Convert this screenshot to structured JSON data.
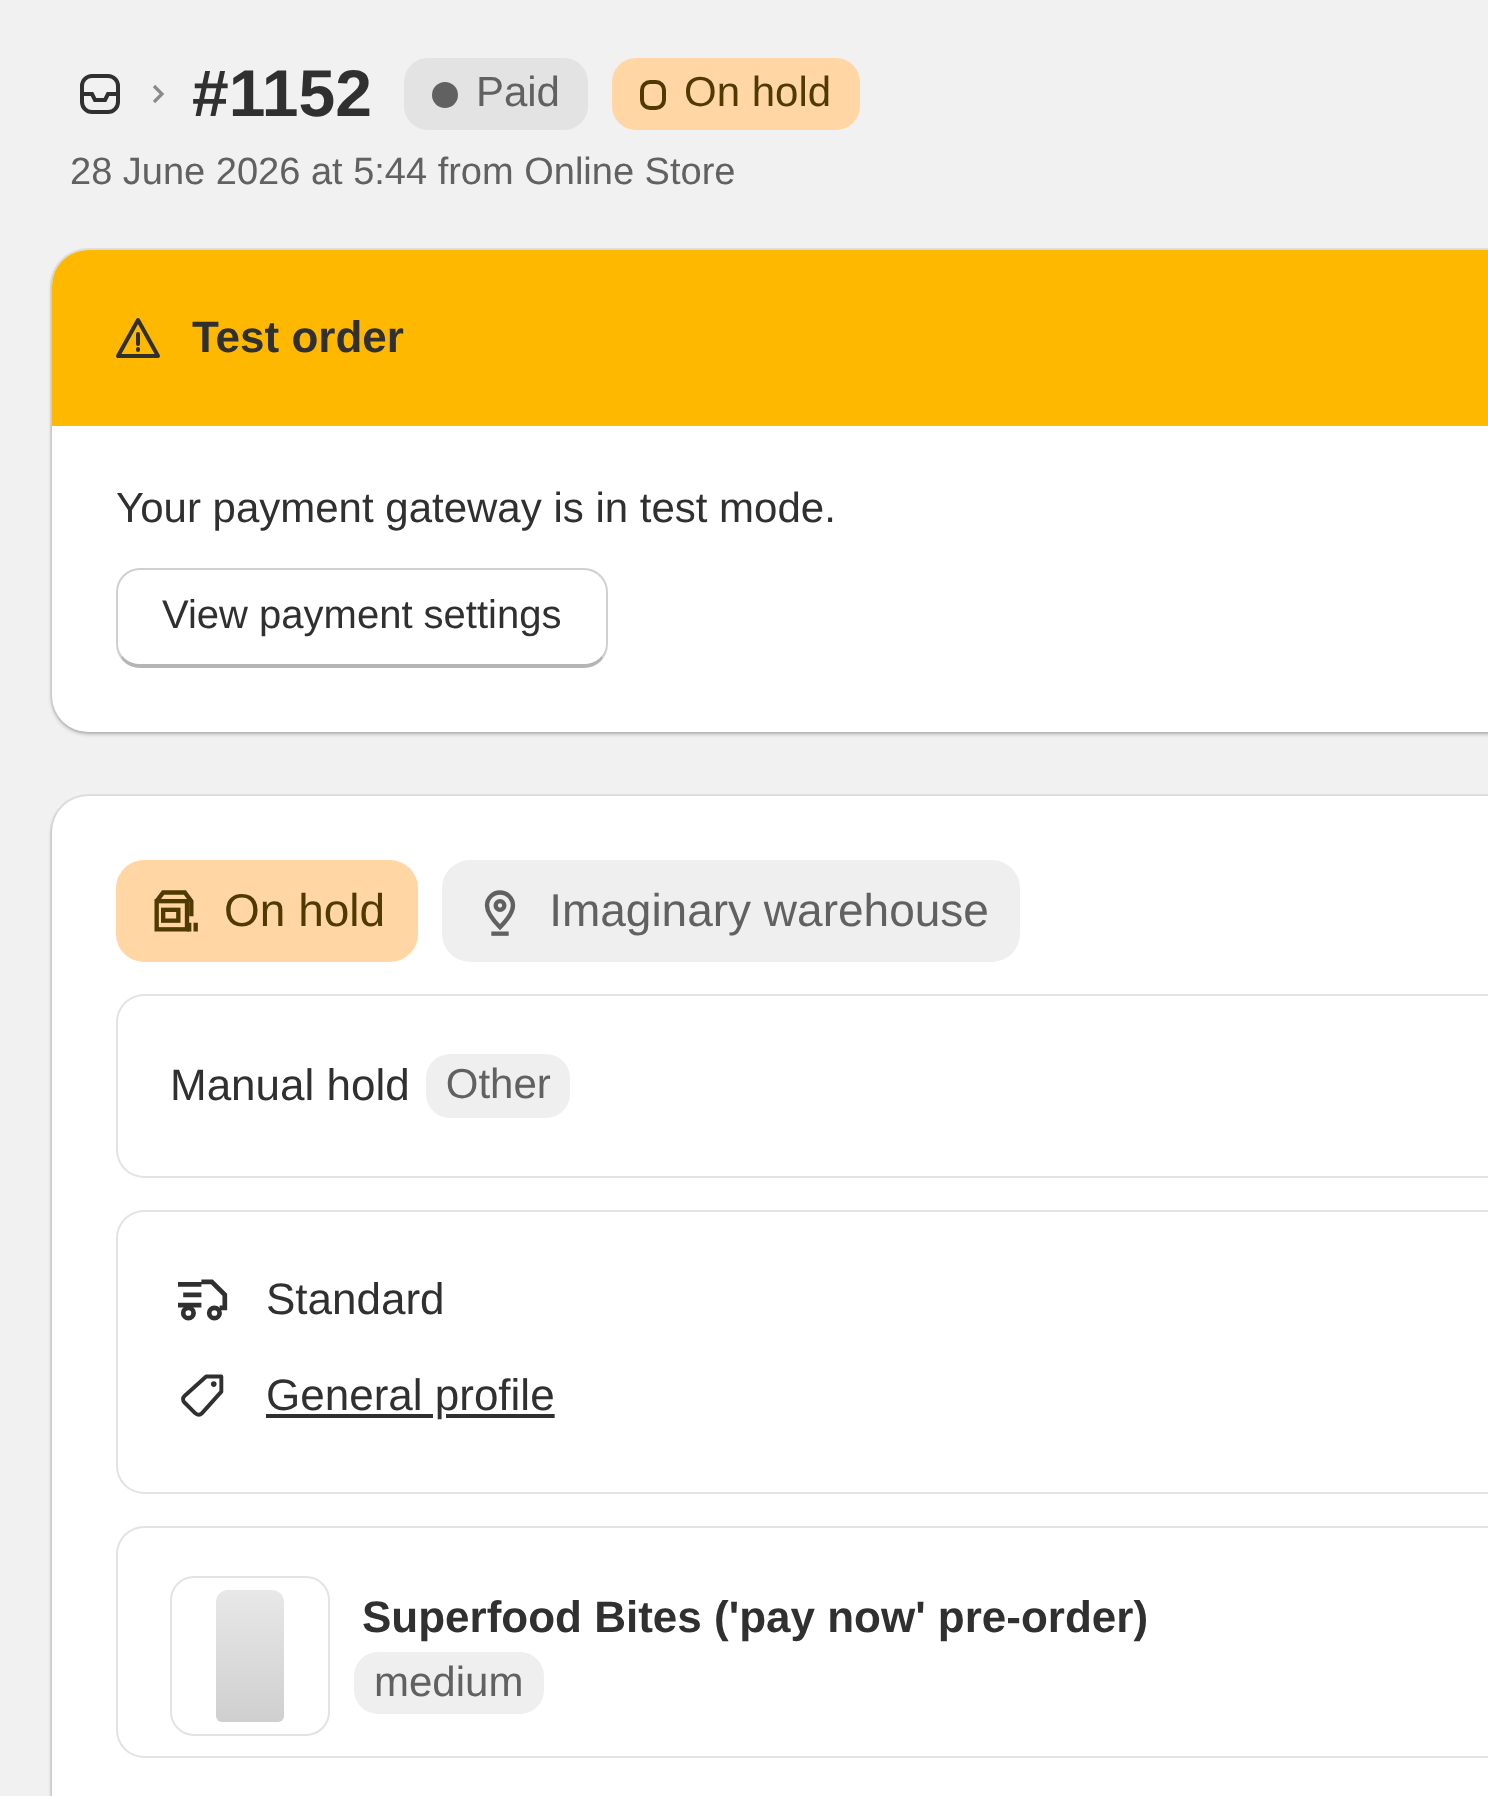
{
  "header": {
    "title": "#1152",
    "badges": [
      {
        "label": "Paid",
        "kind": "paid"
      },
      {
        "label": "On hold",
        "kind": "on_hold"
      }
    ],
    "subtitle": "28 June 2026 at 5:44 from Online Store"
  },
  "banner": {
    "title": "Test order",
    "message": "Your payment gateway is in test mode.",
    "button": "View payment settings"
  },
  "fulfillment": {
    "status": {
      "label": "On hold",
      "kind": "on_hold"
    },
    "location": "Imaginary warehouse",
    "hold_reason": "Manual hold",
    "hold_tag": "Other",
    "shipping_method": "Standard",
    "profile_link": "General profile",
    "items": [
      {
        "name": "Superfood Bites ('pay now' pre-order)",
        "variant": "medium"
      }
    ]
  }
}
